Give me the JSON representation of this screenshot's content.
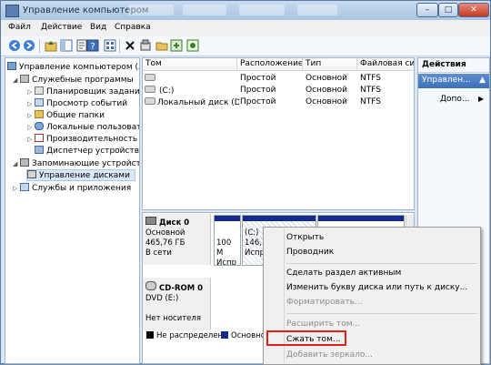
{
  "window": {
    "title": "Управление компьютером",
    "controls": {
      "minimize": "–",
      "maximize": "□",
      "close": "✕"
    }
  },
  "menu": [
    "Файл",
    "Действие",
    "Вид",
    "Справка"
  ],
  "toolbar_icons": [
    "back-icon",
    "forward-icon",
    "up-icon",
    "show-tree-icon",
    "help-icon",
    "properties-icon",
    "delete-icon",
    "settings-icon",
    "open-icon",
    "export-icon"
  ],
  "tree": {
    "root": "Управление компьютером (л",
    "items": [
      "Служебные программы",
      "Планировщик заданий",
      "Просмотр событий",
      "Общие папки",
      "Локальные пользовате",
      "Производительность",
      "Диспетчер устройств",
      "Запоминающие устройст",
      "Управление дисками",
      "Службы и приложения"
    ]
  },
  "volumes": {
    "headers": [
      "Том",
      "Расположение",
      "Тип",
      "Файловая систе"
    ],
    "rows": [
      [
        "",
        "Простой",
        "Основной",
        "NTFS"
      ],
      [
        "(C:)",
        "Простой",
        "Основной",
        "NTFS"
      ],
      [
        "Локальный диск (D:)",
        "Простой",
        "Основной",
        "NTFS"
      ]
    ]
  },
  "actions": {
    "title": "Действия",
    "sub": "Управлен...",
    "more": "Допо..."
  },
  "disks": [
    {
      "name": "Диск 0",
      "type": "Основной",
      "size": "465,76 ГБ",
      "status": "В сети"
    },
    {
      "name": "CD-ROM 0",
      "type": "DVD (E:)",
      "status": "Нет носителя"
    }
  ],
  "partitions": [
    {
      "line1": "100 М",
      "line2": "Испр"
    },
    {
      "line1": "(C:)",
      "line2": "146,",
      "line3": "Испр"
    },
    {
      "line1": "",
      "line2": "",
      "line3": ""
    }
  ],
  "legend": [
    "Не распределен",
    "Основно"
  ],
  "context_menu": {
    "items": [
      {
        "label": "Открыть",
        "disabled": false
      },
      {
        "label": "Проводник",
        "disabled": false
      },
      {
        "label": "Сделать раздел активным",
        "disabled": false
      },
      {
        "label": "Изменить букву диска или путь к диску...",
        "disabled": false
      },
      {
        "label": "Форматировать...",
        "disabled": true
      },
      {
        "label": "Расширить том...",
        "disabled": true
      },
      {
        "label": "Сжать том...",
        "disabled": false
      },
      {
        "label": "Добавить зеркало...",
        "disabled": true
      }
    ]
  },
  "colors": {
    "highlight": "#e0201a",
    "unallocated": "#000000",
    "primary": "#142a8e"
  }
}
